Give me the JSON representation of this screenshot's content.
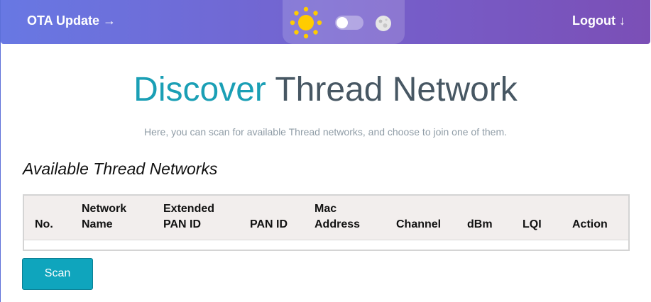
{
  "header": {
    "ota_label": "OTA Update →",
    "logout_label": "Logout ↓",
    "theme_switch": {
      "light_icon": "sun-icon",
      "dark_icon": "moon-icon",
      "state": "light"
    }
  },
  "page": {
    "title_accent": "Discover",
    "title_rest": "Thread Network",
    "subtitle": "Here, you can scan for available Thread networks, and choose to join one of them."
  },
  "networks": {
    "section_title": "Available Thread Networks",
    "columns": {
      "no": "No.",
      "network_name_1": "Network",
      "network_name_2": "Name",
      "ext_pan_1": "Extended",
      "ext_pan_2": "PAN ID",
      "pan_id": "PAN ID",
      "mac_1": "Mac",
      "mac_2": "Address",
      "channel": "Channel",
      "dbm": "dBm",
      "lqi": "LQI",
      "action": "Action"
    },
    "rows": []
  },
  "actions": {
    "scan_label": "Scan"
  },
  "colors": {
    "header_start": "#6878e3",
    "header_end": "#7b4fb6",
    "accent": "#1a9fb5",
    "button": "#0fa5bd",
    "table_header": "#f2eeed"
  }
}
